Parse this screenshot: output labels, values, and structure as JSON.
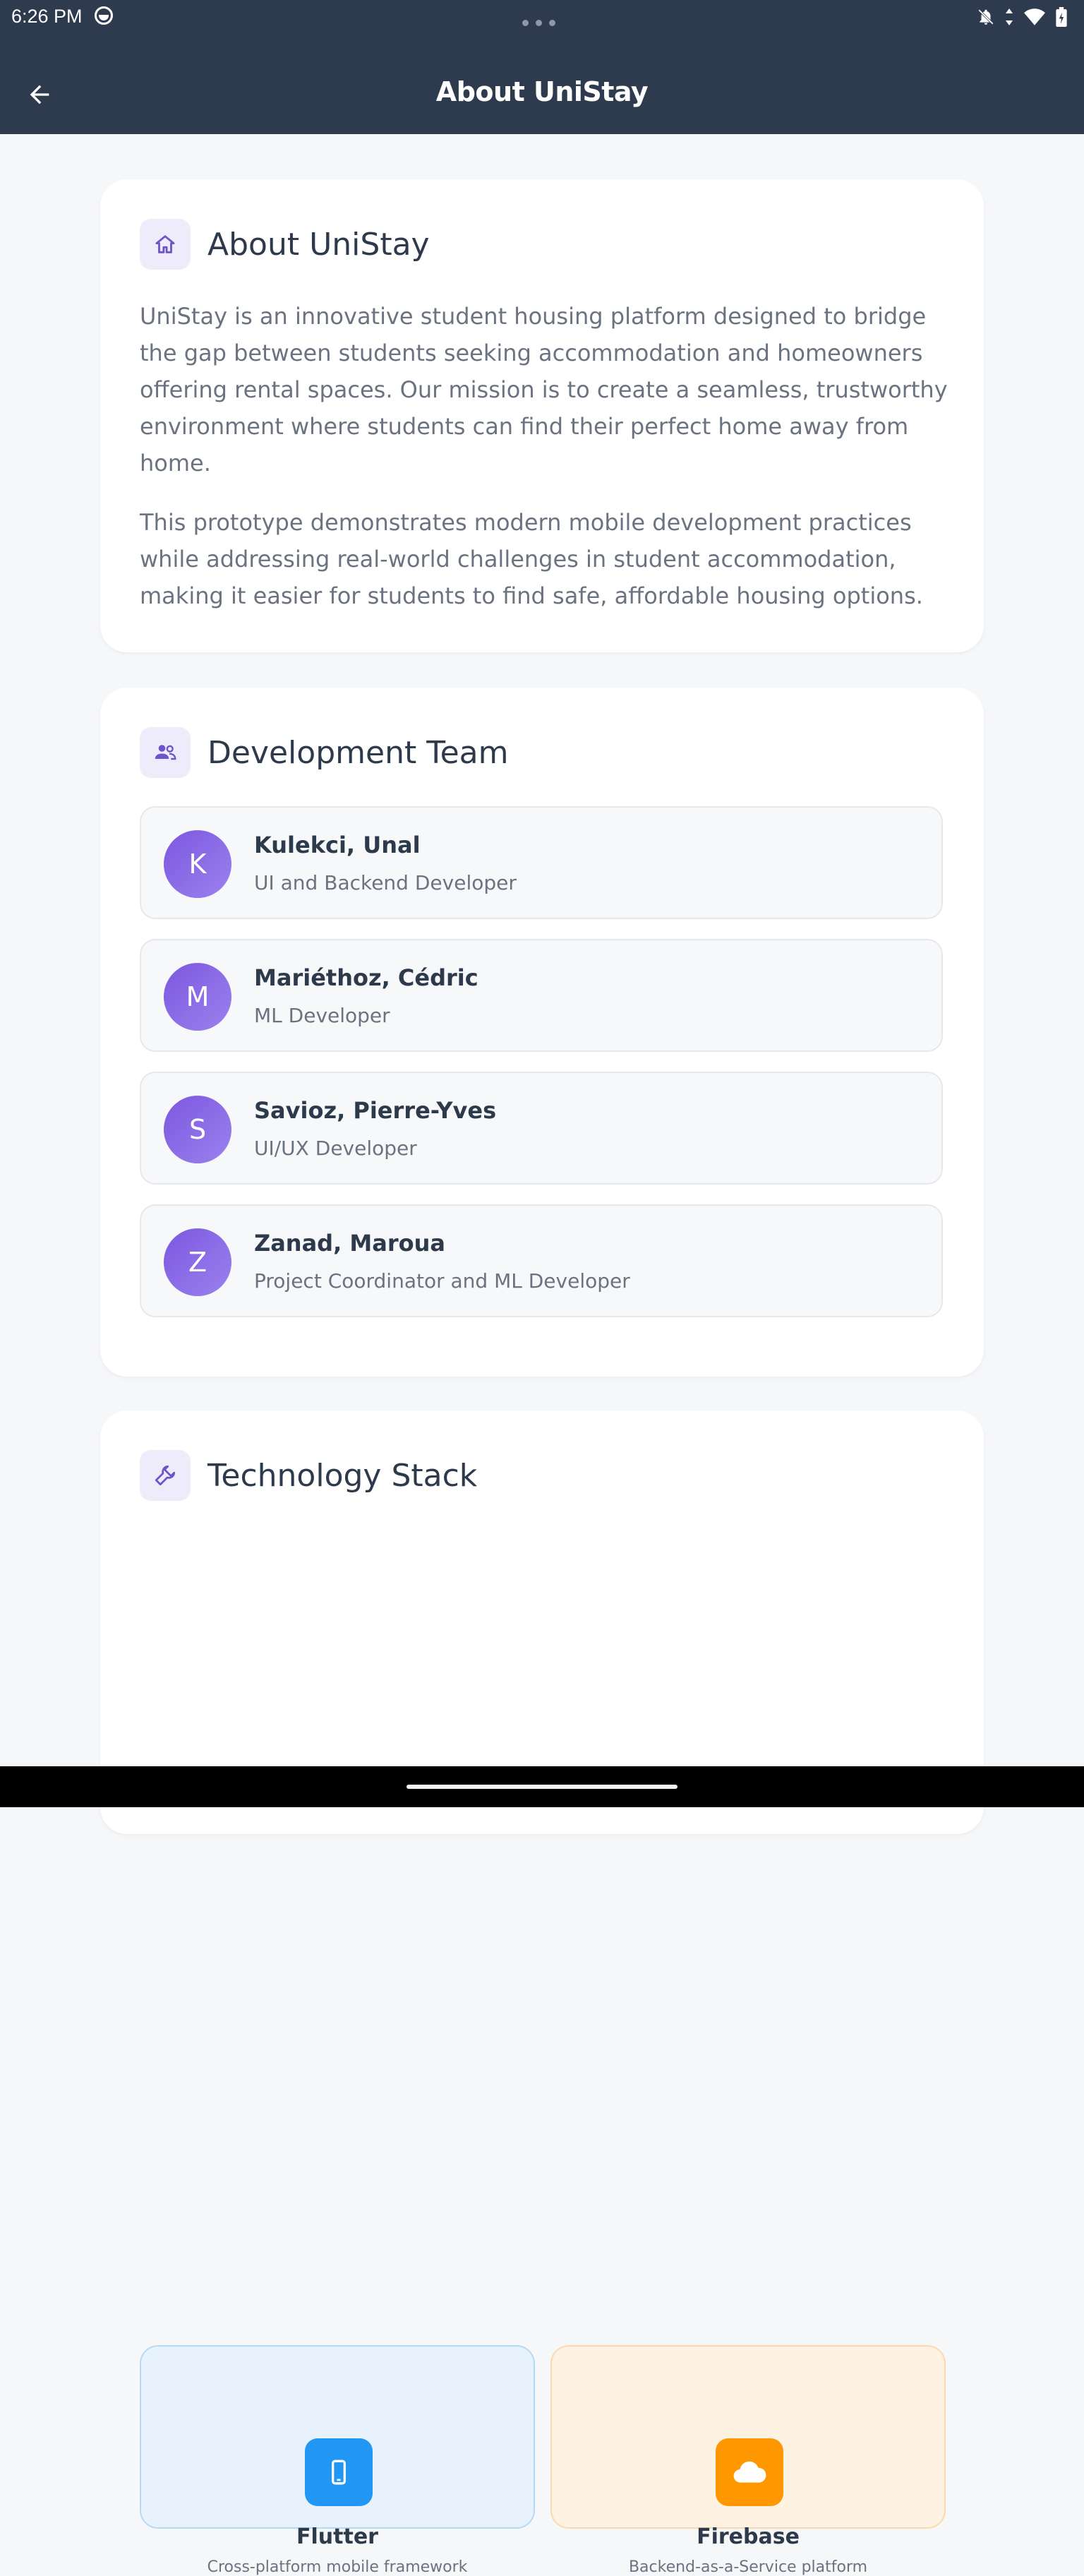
{
  "status_bar": {
    "time": "6:26 PM",
    "icons": [
      "face-icon",
      "more-dots-icon",
      "bell-off-icon",
      "data-arrows-icon",
      "wifi-icon",
      "battery-icon"
    ]
  },
  "app_bar": {
    "title": "About UniStay",
    "back_icon": "arrow-back-icon"
  },
  "about": {
    "icon": "home-icon",
    "title": "About UniStay",
    "paragraph1": "UniStay is an innovative student housing platform designed to bridge the gap between students seeking accommodation and homeowners offering rental spaces. Our mission is to create a seamless, trustworthy environment where students can find their perfect home away from home.",
    "paragraph2": "This prototype demonstrates modern mobile development practices while addressing real-world challenges in student accommodation, making it easier for students to find safe, affordable housing options."
  },
  "team": {
    "icon": "people-icon",
    "title": "Development Team",
    "members": [
      {
        "initial": "K",
        "name": "Kulekci, Unal",
        "role": "UI and Backend Developer"
      },
      {
        "initial": "M",
        "name": "Mariéthoz, Cédric",
        "role": "ML Developer"
      },
      {
        "initial": "S",
        "name": "Savioz, Pierre-Yves",
        "role": "UI/UX Developer"
      },
      {
        "initial": "Z",
        "name": "Zanad, Maroua",
        "role": "Project Coordinator and ML Developer"
      }
    ]
  },
  "tech": {
    "icon": "wrench-icon",
    "title": "Technology Stack",
    "items": [
      {
        "name": "Flutter",
        "description": "Cross-platform mobile framework",
        "icon": "phone-icon",
        "color": "#2196f3"
      },
      {
        "name": "Firebase",
        "description": "Backend-as-a-Service platform",
        "icon": "cloud-icon",
        "color": "#ff9800"
      }
    ]
  },
  "colors": {
    "app_bar": "#2e3b4e",
    "accent": "#7c57df",
    "background": "#f6f7f9"
  }
}
